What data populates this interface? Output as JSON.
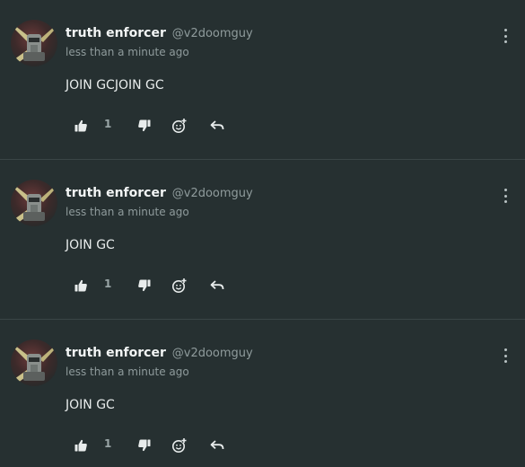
{
  "posts": [
    {
      "author": "truth enforcer",
      "handle": "@v2doomguy",
      "time": "less than a minute ago",
      "content": "JOIN GCJOIN GC",
      "likes": "1"
    },
    {
      "author": "truth enforcer",
      "handle": "@v2doomguy",
      "time": "less than a minute ago",
      "content": "JOIN GC",
      "likes": "1"
    },
    {
      "author": "truth enforcer",
      "handle": "@v2doomguy",
      "time": "less than a minute ago",
      "content": "JOIN GC",
      "likes": "1"
    }
  ],
  "icons": {
    "like": "thumbs-up-icon",
    "dislike": "thumbs-down-icon",
    "react": "add-reaction-icon",
    "reply": "reply-icon",
    "menu": "more-vertical-icon"
  },
  "colors": {
    "background": "#263031",
    "divider": "#3a4546",
    "muted": "#8f9b9c"
  }
}
